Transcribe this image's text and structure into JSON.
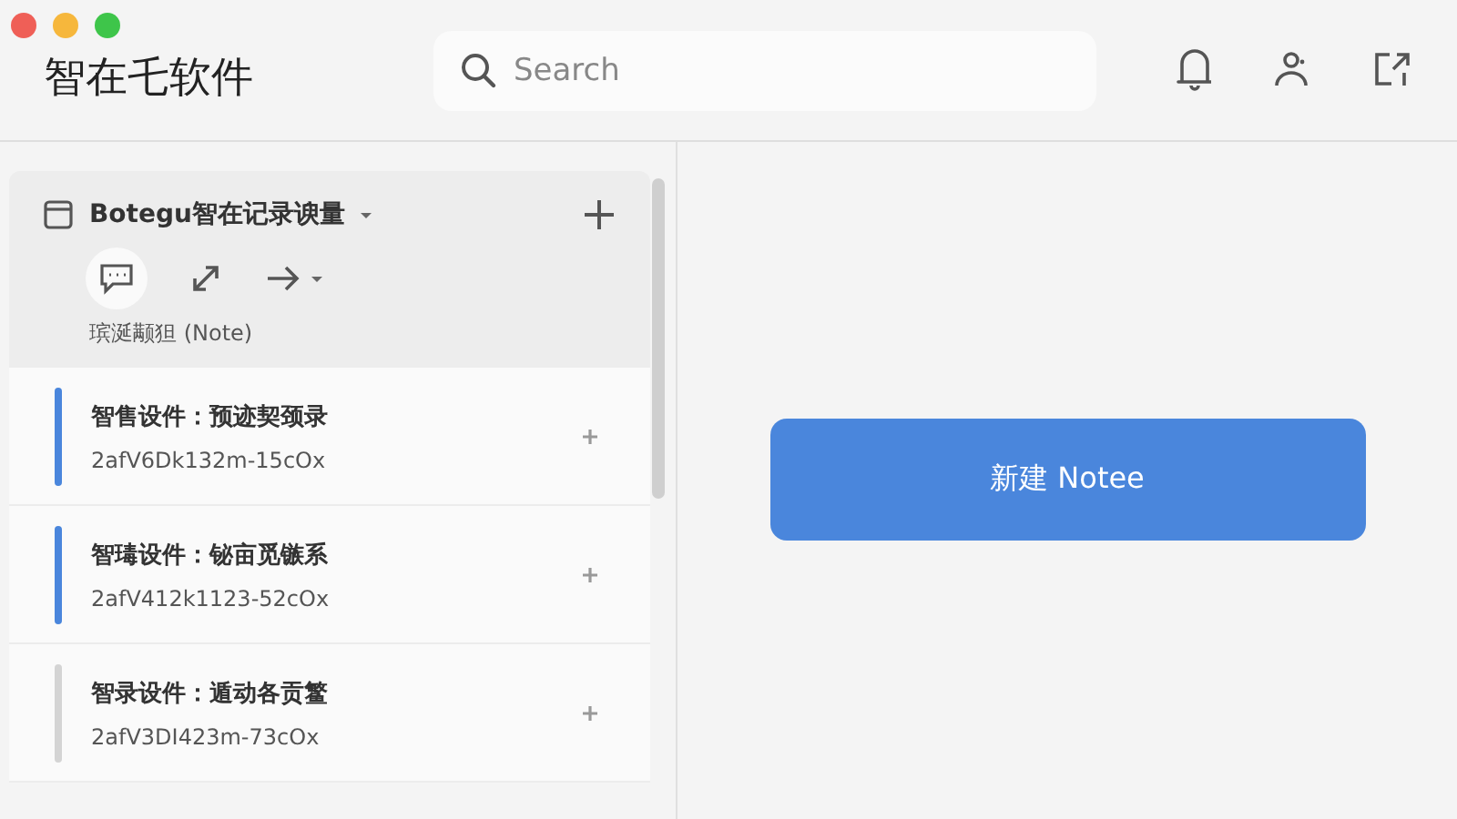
{
  "window": {
    "title": "智在乇软件"
  },
  "search": {
    "placeholder": "Search"
  },
  "sidebar": {
    "header": {
      "title": "Botegu智在记录谀量",
      "caption": "瑸涎颟狚 (Note)"
    },
    "items": [
      {
        "title": "智售设件：预迹契颈录",
        "subtitle": "2afV6Dk132m-15cOx",
        "color": "#4a86dc"
      },
      {
        "title": "智瑇设件：铋亩觅镞系",
        "subtitle": "2afV412k1123-52cOx",
        "color": "#4a86dc"
      },
      {
        "title": "智录设件：遁动各贡鳘",
        "subtitle": "2afV3DI423m-73cOx",
        "color": "#d4d4d4"
      }
    ]
  },
  "main": {
    "button": "新建 Notee"
  }
}
